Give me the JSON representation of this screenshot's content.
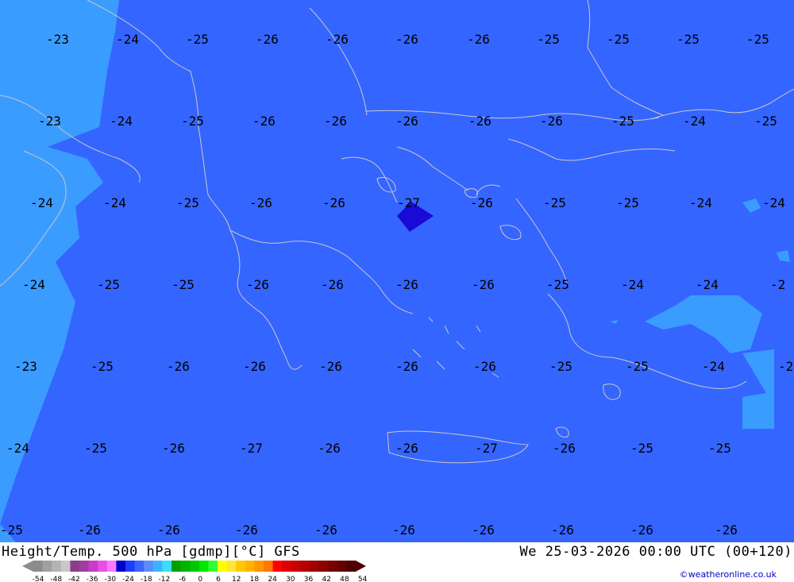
{
  "map": {
    "colors": {
      "main_field": "#3565ff",
      "lighter_field": "#3b9cff",
      "darker_field": "#1a0ad6",
      "coastline": "#c8c8c8"
    },
    "labels": [
      {
        "text": "-23"
      },
      {
        "text": "-24"
      },
      {
        "text": "-25"
      },
      {
        "text": "-26"
      },
      {
        "text": "-26"
      },
      {
        "text": "-26"
      },
      {
        "text": "-26"
      },
      {
        "text": "-25"
      },
      {
        "text": "-25"
      },
      {
        "text": "-25"
      },
      {
        "text": "-25"
      },
      {
        "text": "-23"
      },
      {
        "text": "-24"
      },
      {
        "text": "-25"
      },
      {
        "text": "-26"
      },
      {
        "text": "-26"
      },
      {
        "text": "-26"
      },
      {
        "text": "-26"
      },
      {
        "text": "-26"
      },
      {
        "text": "-25"
      },
      {
        "text": "-24"
      },
      {
        "text": "-25"
      },
      {
        "text": "-24"
      },
      {
        "text": "-24"
      },
      {
        "text": "-25"
      },
      {
        "text": "-26"
      },
      {
        "text": "-26"
      },
      {
        "text": "-27"
      },
      {
        "text": "-26"
      },
      {
        "text": "-25"
      },
      {
        "text": "-25"
      },
      {
        "text": "-24"
      },
      {
        "text": "-24"
      },
      {
        "text": "-24"
      },
      {
        "text": "-25"
      },
      {
        "text": "-25"
      },
      {
        "text": "-26"
      },
      {
        "text": "-26"
      },
      {
        "text": "-26"
      },
      {
        "text": "-26"
      },
      {
        "text": "-25"
      },
      {
        "text": "-24"
      },
      {
        "text": "-24"
      },
      {
        "text": "-2"
      },
      {
        "text": "-23"
      },
      {
        "text": "-25"
      },
      {
        "text": "-26"
      },
      {
        "text": "-26"
      },
      {
        "text": "-26"
      },
      {
        "text": "-26"
      },
      {
        "text": "-26"
      },
      {
        "text": "-25"
      },
      {
        "text": "-25"
      },
      {
        "text": "-24"
      },
      {
        "text": "-2"
      },
      {
        "text": "-24"
      },
      {
        "text": "-25"
      },
      {
        "text": "-26"
      },
      {
        "text": "-27"
      },
      {
        "text": "-26"
      },
      {
        "text": "-26"
      },
      {
        "text": "-27"
      },
      {
        "text": "-26"
      },
      {
        "text": "-25"
      },
      {
        "text": "-25"
      },
      {
        "text": "-25"
      },
      {
        "text": "-26"
      },
      {
        "text": "-26"
      },
      {
        "text": "-26"
      },
      {
        "text": "-26"
      },
      {
        "text": "-26"
      },
      {
        "text": "-26"
      },
      {
        "text": "-26"
      },
      {
        "text": "-26"
      },
      {
        "text": "-26"
      }
    ]
  },
  "footer": {
    "title": "Height/Temp. 500 hPa [gdmp][°C] GFS",
    "datetime": "We 25-03-2026 00:00 UTC (00+120)",
    "credit": "©weatheronline.co.uk"
  },
  "colorbar": {
    "ticks": [
      "-54",
      "-48",
      "-42",
      "-36",
      "-30",
      "-24",
      "-18",
      "-12",
      "-6",
      "0",
      "6",
      "12",
      "18",
      "24",
      "30",
      "36",
      "42",
      "48",
      "54"
    ],
    "colors": [
      "#8c8c8c",
      "#a0a0a0",
      "#b4b4b4",
      "#c8c8c8",
      "#8c3c8c",
      "#a03ca0",
      "#c83cc8",
      "#e650e6",
      "#ff78ff",
      "#0000c8",
      "#1e3cff",
      "#3c64ff",
      "#5a8cff",
      "#3cb4ff",
      "#3cdcff",
      "#00a000",
      "#00b400",
      "#00c800",
      "#00e600",
      "#32ff32",
      "#ffff00",
      "#ffe632",
      "#ffc800",
      "#ffb400",
      "#ff9600",
      "#ff7800",
      "#ff0000",
      "#dc0000",
      "#c80000",
      "#b40000",
      "#a00000",
      "#8c0000",
      "#780000",
      "#640000",
      "#500000"
    ]
  }
}
